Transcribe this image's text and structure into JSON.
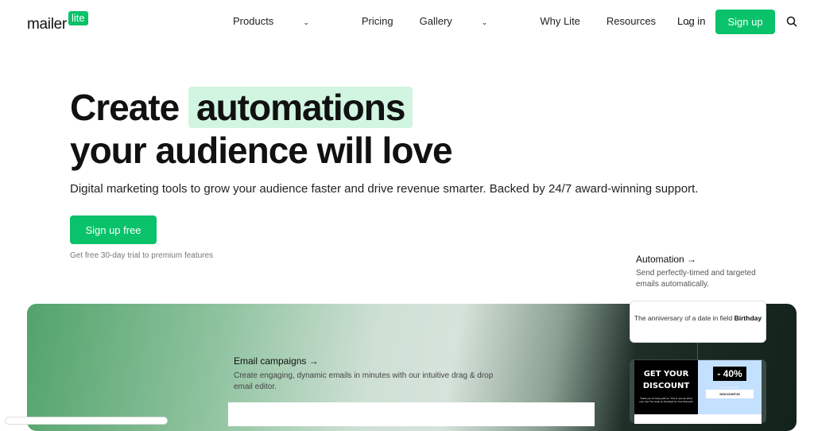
{
  "nav": {
    "logo_main": "mailer",
    "logo_badge": "lite",
    "items": [
      {
        "label": "Products",
        "dropdown": true
      },
      {
        "label": "Pricing",
        "dropdown": false
      },
      {
        "label": "Gallery",
        "dropdown": true
      },
      {
        "label": "Why Lite",
        "dropdown": false
      },
      {
        "label": "Resources",
        "dropdown": true
      }
    ],
    "login": "Log in",
    "signup": "Sign up",
    "search_icon": "search-icon"
  },
  "hero": {
    "title_pre": "Create",
    "title_highlight": "automations",
    "title_line2": "your audience will love",
    "subtitle": "Digital marketing tools to grow your audience faster and drive revenue smarter. Backed by 24/7 award-winning support.",
    "cta": "Sign up free",
    "trial_note": "Get free 30-day trial to premium features"
  },
  "features": {
    "email_campaigns": {
      "title": "Email campaigns →",
      "desc": "Create engaging, dynamic emails in minutes with our intuitive drag & drop email editor."
    },
    "automation": {
      "title": "Automation →",
      "desc": "Send perfectly-timed and targeted emails automatically."
    }
  },
  "trigger": {
    "text": "The anniversary of a date in field",
    "field": "Birthday"
  },
  "email_preview": {
    "headline": "GET YOUR DISCOUNT",
    "small": "Thank you for being with us. This is new we show one! Use The Code at The Right for Your Discount!",
    "percent": "- 40%",
    "code_label": "Your code to use",
    "code": "DISCOUNT40"
  },
  "colors": {
    "brand": "#09c269",
    "highlight": "#d1f5e0"
  }
}
